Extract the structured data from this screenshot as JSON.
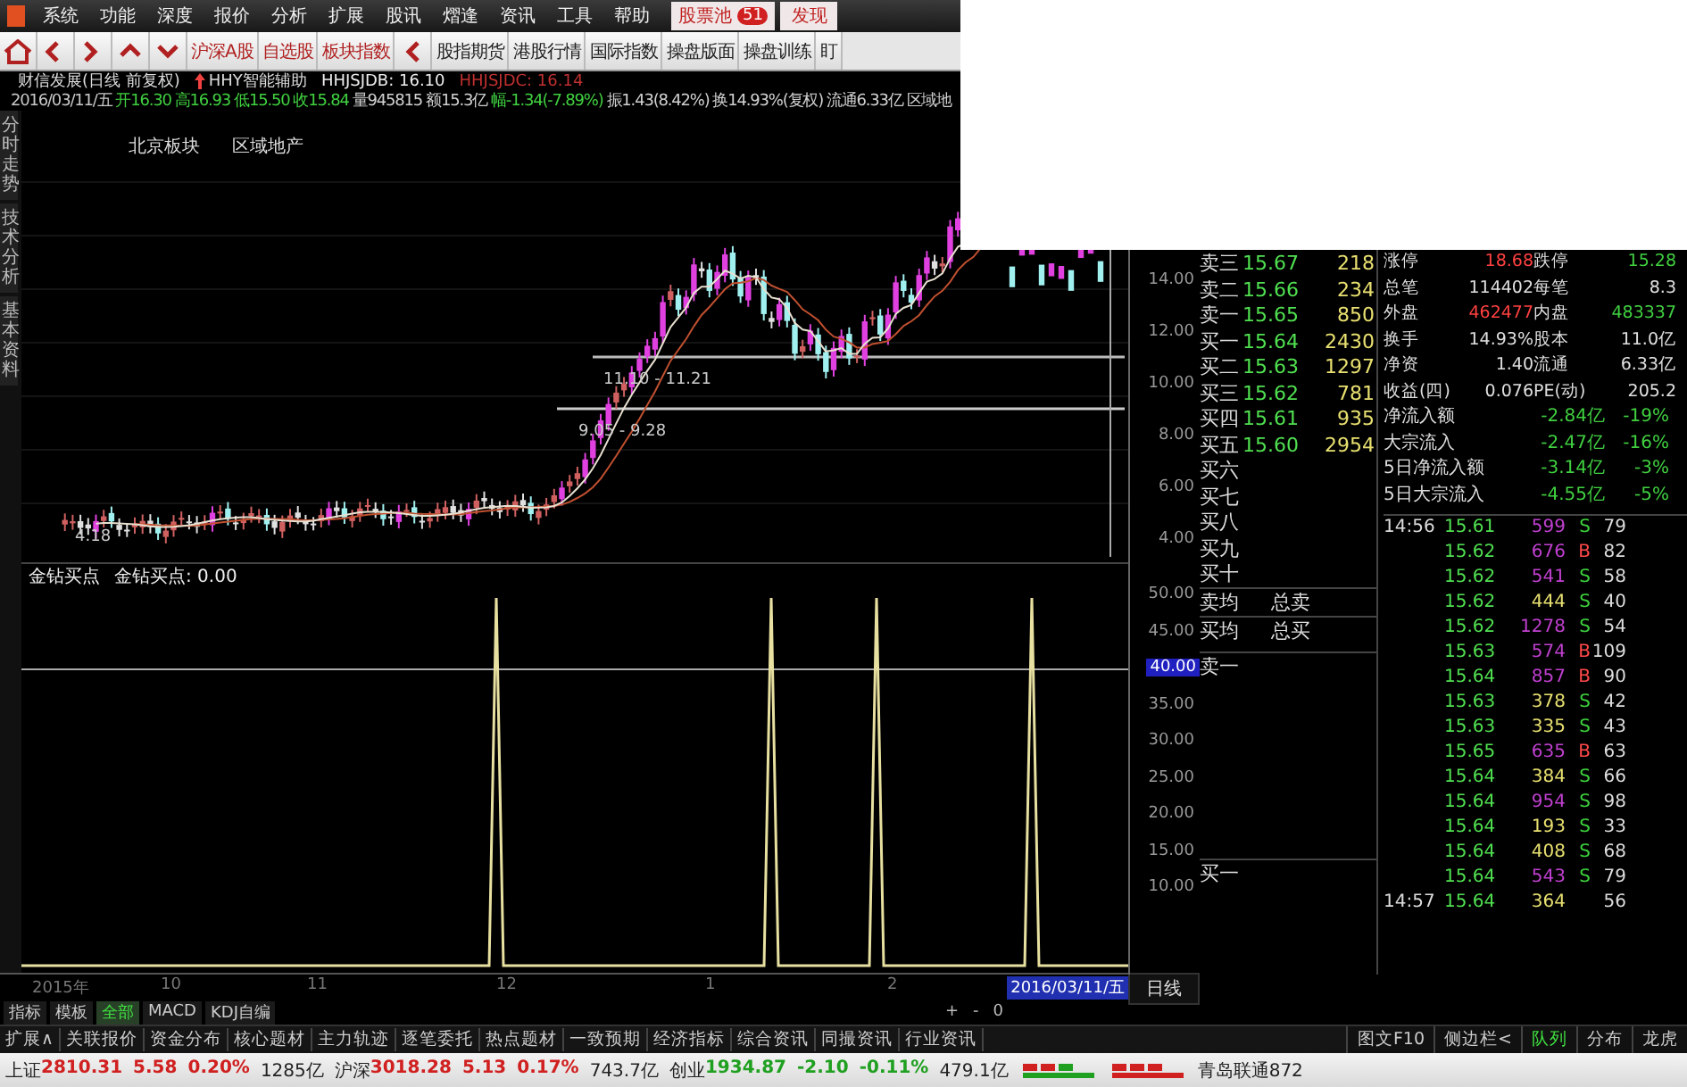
{
  "menu": [
    "系统",
    "功能",
    "深度",
    "报价",
    "分析",
    "扩展",
    "股讯",
    "熠逢",
    "资讯",
    "工具",
    "帮助"
  ],
  "menu_extra": {
    "stock_pool": "股票池",
    "badge": "51",
    "discover": "发现"
  },
  "toolbar": {
    "nav": [
      "沪深A股",
      "自选股",
      "板块指数"
    ],
    "links": [
      "股指期货",
      "港股行情",
      "国际指数",
      "操盘版面",
      "操盘训练",
      "盯"
    ]
  },
  "info": {
    "title": "财信发展(日线 前复权)",
    "assist": "HHY智能辅助",
    "jdb": "HHJSJDB: 16.10",
    "jdc": "HHJSJDC: 16.14"
  },
  "quote_line": [
    {
      "text": "2016/03/11/五",
      "color": "#c8c8c8"
    },
    {
      "text": "开16.30",
      "color": "#40d040"
    },
    {
      "text": "高16.93",
      "color": "#40d040"
    },
    {
      "text": "低15.50",
      "color": "#40d040"
    },
    {
      "text": "收15.84",
      "color": "#40d040"
    },
    {
      "text": "量945815",
      "color": "#d0d0d0"
    },
    {
      "text": "额15.3亿",
      "color": "#d0d0d0"
    },
    {
      "text": "幅-1.34(-7.89%)",
      "color": "#40d040"
    },
    {
      "text": "振1.43(8.42%)",
      "color": "#d0d0d0"
    },
    {
      "text": "换14.93%(复权)",
      "color": "#d0d0d0"
    },
    {
      "text": "流通6.33亿",
      "color": "#d0d0d0"
    },
    {
      "text": "区域地",
      "color": "#d0d0d0"
    }
  ],
  "side_tabs": [
    "分时走势",
    "技术分析",
    "基本资料"
  ],
  "price_chart": {
    "sectors": [
      "北京板块",
      "区域地产"
    ],
    "low_label": "4.18",
    "range_labels": [
      "11.10 - 11.21",
      "9.05 - 9.28"
    ],
    "y_ticks": [
      "14.00",
      "12.00",
      "10.00",
      "8.00",
      "6.00",
      "4.00"
    ]
  },
  "indicator": {
    "name": "金钻买点",
    "value_label": "金钻买点: 0.00",
    "y_ticks": [
      {
        "label": "50.00",
        "highlighted": false
      },
      {
        "label": "45.00",
        "highlighted": false
      },
      {
        "label": "40.00",
        "highlighted": true
      },
      {
        "label": "35.00",
        "highlighted": false
      },
      {
        "label": "30.00",
        "highlighted": false
      },
      {
        "label": "25.00",
        "highlighted": false
      },
      {
        "label": "20.00",
        "highlighted": false
      },
      {
        "label": "15.00",
        "highlighted": false
      },
      {
        "label": "10.00",
        "highlighted": false
      }
    ]
  },
  "x_axis": {
    "labels": [
      "2015年",
      "10",
      "11",
      "12",
      "1",
      "2"
    ],
    "cursor_date": "2016/03/11/五",
    "period": "日线"
  },
  "indicator_tabs": [
    {
      "label": "指标",
      "selected": false
    },
    {
      "label": "模板",
      "selected": false
    },
    {
      "label": "全部",
      "selected": true
    },
    {
      "label": "MACD",
      "selected": false
    },
    {
      "label": "KDJ自编",
      "selected": false
    }
  ],
  "zoom_controls": [
    "+",
    "-",
    "0"
  ],
  "function_tabs": [
    "扩展∧",
    "关联报价",
    "资金分布",
    "核心题材",
    "主力轨迹",
    "逐笔委托",
    "热点题材",
    "一致预期",
    "经济指标",
    "综合资讯",
    "同撮资讯",
    "行业资讯"
  ],
  "side_buttons": [
    {
      "label": "图文F10",
      "selected": false
    },
    {
      "label": "侧边栏<",
      "selected": false
    },
    {
      "label": "队列",
      "selected": true
    },
    {
      "label": "分布",
      "selected": false
    },
    {
      "label": "龙虎",
      "selected": false
    }
  ],
  "order_book": {
    "rows": [
      {
        "label": "卖三",
        "price": "15.67",
        "volume": "218"
      },
      {
        "label": "卖二",
        "price": "15.66",
        "volume": "234"
      },
      {
        "label": "卖一",
        "price": "15.65",
        "volume": "850"
      },
      {
        "label": "买一",
        "price": "15.64",
        "volume": "2430"
      },
      {
        "label": "买二",
        "price": "15.63",
        "volume": "1297"
      },
      {
        "label": "买三",
        "price": "15.62",
        "volume": "781"
      },
      {
        "label": "买四",
        "price": "15.61",
        "volume": "935"
      },
      {
        "label": "买五",
        "price": "15.60",
        "volume": "2954"
      },
      {
        "label": "买六"
      },
      {
        "label": "买七"
      },
      {
        "label": "买八"
      },
      {
        "label": "买九"
      },
      {
        "label": "买十"
      }
    ],
    "summary": [
      {
        "label": "卖均",
        "total": "总卖"
      },
      {
        "label": "买均",
        "total": "总买"
      }
    ],
    "queue": [
      "卖一",
      "买一"
    ]
  },
  "stats": [
    {
      "label": "涨停",
      "value": "18.68",
      "color": "#ff4040"
    },
    {
      "label": "跌停",
      "value": "15.28",
      "color": "#40d040"
    },
    {
      "label": "总笔",
      "value": "114402",
      "color": "#e0e0e0"
    },
    {
      "label": "每笔",
      "value": "8.3",
      "color": "#e0e0e0"
    },
    {
      "label": "外盘",
      "value": "462477",
      "color": "#ff4040"
    },
    {
      "label": "内盘",
      "value": "483337",
      "color": "#40d040"
    },
    {
      "label": "换手",
      "value": "14.93%",
      "color": "#e0e0e0"
    },
    {
      "label": "股本",
      "value": "11.0亿",
      "color": "#e0e0e0"
    },
    {
      "label": "净资",
      "value": "1.40",
      "color": "#e0e0e0"
    },
    {
      "label": "流通",
      "value": "6.33亿",
      "color": "#e0e0e0"
    },
    {
      "label": "收益(四)",
      "value": "0.076",
      "color": "#e0e0e0"
    },
    {
      "label": "PE(动)",
      "value": "205.2",
      "color": "#e0e0e0"
    }
  ],
  "flows": [
    {
      "label": "净流入额",
      "amount": "-2.84亿",
      "pct": "-19%"
    },
    {
      "label": "大宗流入",
      "amount": "-2.47亿",
      "pct": "-16%"
    },
    {
      "label": "5日净流入额",
      "amount": "-3.14亿",
      "pct": "-3%"
    },
    {
      "label": "5日大宗流入",
      "amount": "-4.55亿",
      "pct": "-5%"
    }
  ],
  "ticks": [
    {
      "time": "14:56",
      "price": "15.61",
      "volume": "599",
      "color": "#c040d0",
      "kind": "sell",
      "side": "S",
      "extra": "79"
    },
    {
      "price": "15.62",
      "volume": "676",
      "color": "#c040d0",
      "kind": "buy",
      "side": "B",
      "extra": "82"
    },
    {
      "price": "15.62",
      "volume": "541",
      "color": "#c040d0",
      "kind": "sell",
      "side": "S",
      "extra": "58"
    },
    {
      "price": "15.62",
      "volume": "444",
      "color": "#e8e070",
      "kind": "sell",
      "side": "S",
      "extra": "40"
    },
    {
      "price": "15.62",
      "volume": "1278",
      "color": "#c040d0",
      "kind": "sell",
      "side": "S",
      "extra": "54"
    },
    {
      "price": "15.63",
      "volume": "574",
      "color": "#c040d0",
      "kind": "buy",
      "side": "B",
      "extra": "109"
    },
    {
      "price": "15.64",
      "volume": "857",
      "color": "#c040d0",
      "kind": "buy",
      "side": "B",
      "extra": "90"
    },
    {
      "price": "15.63",
      "volume": "378",
      "color": "#e8e070",
      "kind": "sell",
      "side": "S",
      "extra": "42"
    },
    {
      "price": "15.63",
      "volume": "335",
      "color": "#e8e070",
      "kind": "sell",
      "side": "S",
      "extra": "43"
    },
    {
      "price": "15.65",
      "volume": "635",
      "color": "#c040d0",
      "kind": "buy",
      "side": "B",
      "extra": "63"
    },
    {
      "price": "15.64",
      "volume": "384",
      "color": "#e8e070",
      "kind": "sell",
      "side": "S",
      "extra": "66"
    },
    {
      "price": "15.64",
      "volume": "954",
      "color": "#c040d0",
      "kind": "sell",
      "side": "S",
      "extra": "98"
    },
    {
      "price": "15.64",
      "volume": "193",
      "color": "#e8e070",
      "kind": "sell",
      "side": "S",
      "extra": "33"
    },
    {
      "price": "15.64",
      "volume": "408",
      "color": "#e8e070",
      "kind": "sell",
      "side": "S",
      "extra": "68"
    },
    {
      "price": "15.64",
      "volume": "543",
      "color": "#c040d0",
      "kind": "sell",
      "side": "S",
      "extra": "79"
    },
    {
      "time": "14:57",
      "price": "15.64",
      "volume": "364",
      "color": "#e8e070",
      "kind": "none",
      "extra": "56"
    }
  ],
  "status_bar": {
    "indices": [
      {
        "name": "上证",
        "value": "2810.31",
        "change": "5.58",
        "pct": "0.20%",
        "amount": "1285亿",
        "color": "#d02020"
      },
      {
        "name": "沪深",
        "value": "3018.28",
        "change": "5.13",
        "pct": "0.17%",
        "amount": "743.7亿",
        "color": "#d02020"
      },
      {
        "name": "创业",
        "value": "1934.87",
        "change": "-2.10",
        "pct": "-0.11%",
        "amount": "479.1亿",
        "color": "#20a020"
      }
    ],
    "ticker": "青岛联通872"
  }
}
